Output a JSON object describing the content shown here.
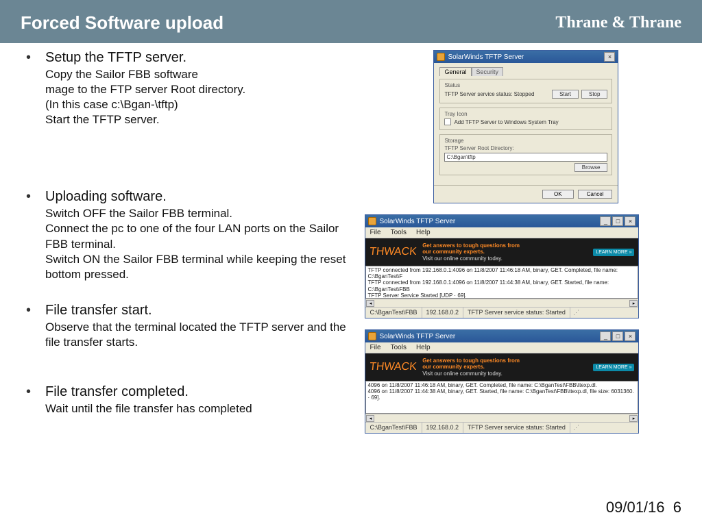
{
  "header": {
    "title": "Forced Software upload",
    "brand": "Thrane & Thrane"
  },
  "bullets": {
    "b1": {
      "title": "Setup the TFTP server.",
      "l1": "Copy the Sailor FBB software",
      "l2": "mage to the FTP server Root directory.",
      "l3": "(In this case c:\\Bgan-\\tftp)",
      "l4": "Start the TFTP server."
    },
    "b2": {
      "title": "Uploading software.",
      "l1": "Switch OFF the Sailor FBB terminal.",
      "l2": "Connect the pc to one of the four LAN ports on the Sailor FBB terminal.",
      "l3": "Switch ON the Sailor FBB terminal while keeping the reset bottom pressed."
    },
    "b3": {
      "title": "File transfer start.",
      "l1": "Observe that the terminal located the TFTP server and the file transfer starts."
    },
    "b4": {
      "title": "File transfer completed.",
      "l1": "Wait until the file transfer has completed"
    }
  },
  "win1": {
    "title": "SolarWinds TFTP Server",
    "tabs": {
      "general": "General",
      "security": "Security"
    },
    "status_group": "Status",
    "status_label": "TFTP Server service status: Stopped",
    "start": "Start",
    "stop": "Stop",
    "tray_group": "Tray Icon",
    "tray_check": "Add TFTP Server to Windows System Tray",
    "storage_group": "Storage",
    "root_label": "TFTP Server Root Directory:",
    "root_value": "C:\\Bgan\\tftp",
    "browse": "Browse",
    "ok": "OK",
    "cancel": "Cancel"
  },
  "win2": {
    "title": "SolarWinds TFTP Server",
    "menu": {
      "file": "File",
      "tools": "Tools",
      "help": "Help"
    },
    "banner": {
      "logo": "THWACK",
      "line1": "Get answers to tough questions from",
      "line2": "our community experts.",
      "line3": "Visit our online community today.",
      "cta": "LEARN MORE »"
    },
    "log": {
      "l1": "TFTP connected from 192.168.0.1:4096 on 11/8/2007 11:46:18 AM, binary, GET. Completed, file name: C:\\BganTest\\F",
      "l2": "TFTP connected from 192.168.0.1:4096 on 11/8/2007 11:44:38 AM, binary, GET. Started, file name: C:\\BganTest\\FBB",
      "l3": "TFTP Server Service Started [UDP · 69]."
    },
    "status": {
      "s1": "C:\\BganTest\\FBB",
      "s2": "192.168.0.2",
      "s3": "TFTP Server service status: Started"
    }
  },
  "win3": {
    "log": {
      "l1": "4096 on 11/8/2007 11:46:18 AM, binary, GET. Completed, file name: C:\\BganTest\\FBB\\ttexp.dl.",
      "l2": "4096 on 11/8/2007 11:44:38 AM, binary, GET. Started, file name: C:\\BganTest\\FBB\\ttexp.dl, file size: 6031360.",
      "l3": "· 69]."
    }
  },
  "footer": {
    "date": "09/01/16",
    "page": "6"
  }
}
